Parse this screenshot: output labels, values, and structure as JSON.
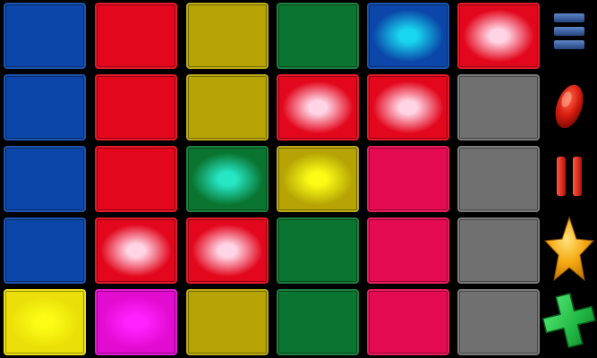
{
  "colors": {
    "blue": "#0b46a8",
    "red": "#e2071c",
    "olive": "#b5a404",
    "green": "#0a7530",
    "crimson": "#e50b52",
    "gray": "#707070",
    "magenta": "#e20bd0",
    "yellow": "#eadf08"
  },
  "grid": {
    "rows": 5,
    "cols": 6,
    "cells": [
      [
        {
          "color": "blue",
          "lit": false
        },
        {
          "color": "red",
          "lit": false
        },
        {
          "color": "olive",
          "lit": false
        },
        {
          "color": "green",
          "lit": false
        },
        {
          "color": "blue",
          "lit": true,
          "glow": "#19d6f0"
        },
        {
          "color": "red",
          "lit": true,
          "glow": "#ffd4e4"
        }
      ],
      [
        {
          "color": "blue",
          "lit": false
        },
        {
          "color": "red",
          "lit": false
        },
        {
          "color": "olive",
          "lit": false
        },
        {
          "color": "red",
          "lit": true,
          "glow": "#ffd4e4"
        },
        {
          "color": "red",
          "lit": true,
          "glow": "#ffd4e4"
        },
        {
          "color": "gray",
          "lit": false
        }
      ],
      [
        {
          "color": "blue",
          "lit": false
        },
        {
          "color": "red",
          "lit": false
        },
        {
          "color": "green",
          "lit": true,
          "glow": "#26e6c4"
        },
        {
          "color": "olive",
          "lit": true,
          "glow": "#fbfb15"
        },
        {
          "color": "crimson",
          "lit": false
        },
        {
          "color": "gray",
          "lit": false
        }
      ],
      [
        {
          "color": "blue",
          "lit": false
        },
        {
          "color": "red",
          "lit": true,
          "glow": "#ffd4e4"
        },
        {
          "color": "red",
          "lit": true,
          "glow": "#ffd4e4"
        },
        {
          "color": "green",
          "lit": false
        },
        {
          "color": "crimson",
          "lit": false
        },
        {
          "color": "gray",
          "lit": false
        }
      ],
      [
        {
          "color": "yellow",
          "lit": true,
          "glow": "#fbfb15"
        },
        {
          "color": "magenta",
          "lit": true,
          "glow": "#ff22ff"
        },
        {
          "color": "olive",
          "lit": false
        },
        {
          "color": "green",
          "lit": false
        },
        {
          "color": "crimson",
          "lit": false
        },
        {
          "color": "gray",
          "lit": false
        }
      ]
    ]
  },
  "sidebar": {
    "buttons": [
      {
        "name": "menu-button",
        "icon": "menu-icon"
      },
      {
        "name": "record-button",
        "icon": "record-icon"
      },
      {
        "name": "pause-button",
        "icon": "pause-icon"
      },
      {
        "name": "favorite-button",
        "icon": "star-icon"
      },
      {
        "name": "add-button",
        "icon": "plus-icon"
      }
    ]
  }
}
